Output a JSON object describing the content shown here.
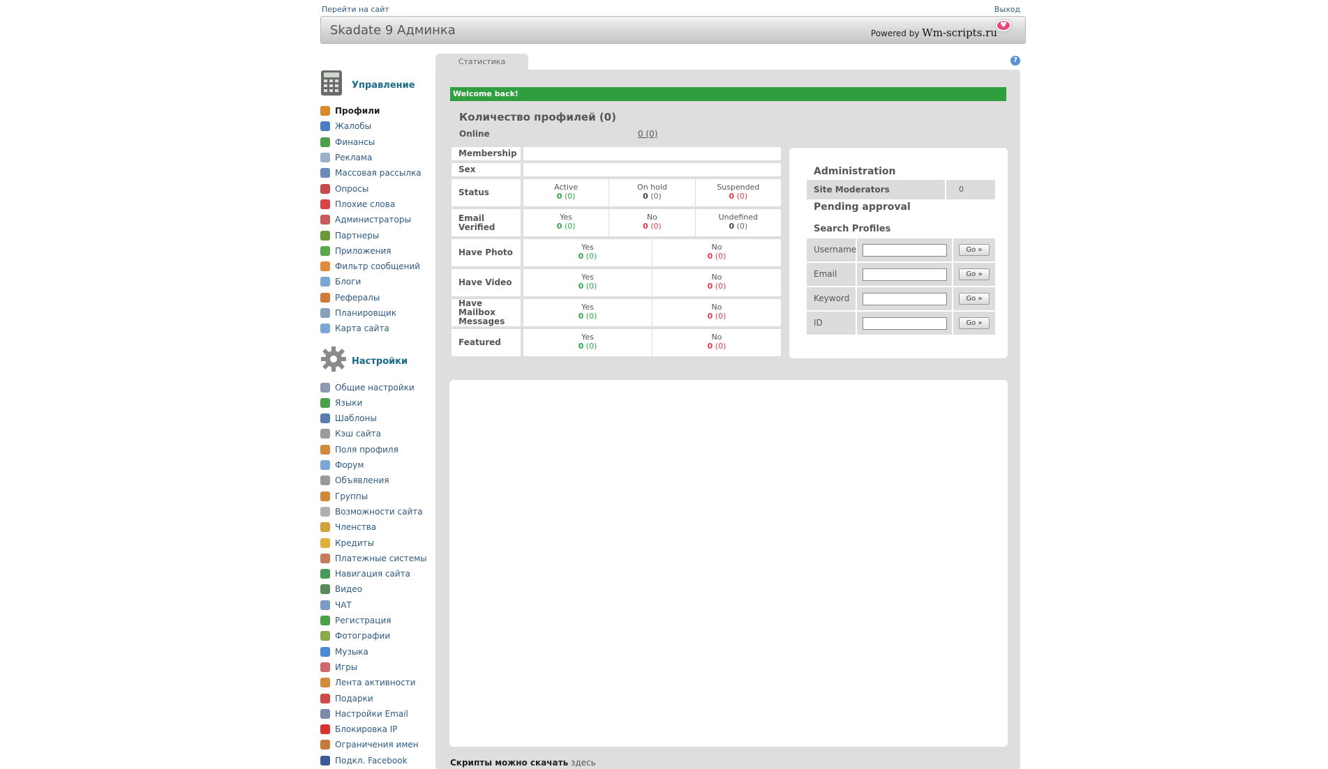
{
  "top": {
    "left_link": "Перейти на сайт",
    "right_link": "Выход"
  },
  "header": {
    "title": "Skadate 9 Админка",
    "powered_prefix": "Powered by",
    "powered_brand": "Wm-scripts.ru"
  },
  "sidebar": {
    "management": {
      "title": "Управление",
      "items": [
        {
          "label": "Профили",
          "color": "#d98a2a"
        },
        {
          "label": "Жалобы",
          "color": "#4a7ec4"
        },
        {
          "label": "Финансы",
          "color": "#4aa14a"
        },
        {
          "label": "Реклама",
          "color": "#9ab0c8"
        },
        {
          "label": "Массовая рассылка",
          "color": "#6d8ab8"
        },
        {
          "label": "Опросы",
          "color": "#c84a4a"
        },
        {
          "label": "Плохие слова",
          "color": "#d94343"
        },
        {
          "label": "Администраторы",
          "color": "#c85a5a"
        },
        {
          "label": "Партнеры",
          "color": "#6a9a3a"
        },
        {
          "label": "Приложения",
          "color": "#5aa84a"
        },
        {
          "label": "Фильтр сообщений",
          "color": "#e08a3a"
        },
        {
          "label": "Блоги",
          "color": "#7aa6d8"
        },
        {
          "label": "Рефералы",
          "color": "#d07a3a"
        },
        {
          "label": "Планировщик",
          "color": "#8aa0c0"
        },
        {
          "label": "Карта сайта",
          "color": "#7aa6d8"
        }
      ]
    },
    "settings": {
      "title": "Настройки",
      "items": [
        {
          "label": "Общие настройки",
          "color": "#8a9ab0"
        },
        {
          "label": "Языки",
          "color": "#4aa14a"
        },
        {
          "label": "Шаблоны",
          "color": "#5a7ab0"
        },
        {
          "label": "Кэш сайта",
          "color": "#9a9a9a"
        },
        {
          "label": "Поля профиля",
          "color": "#d08a3a"
        },
        {
          "label": "Форум",
          "color": "#7aa6d8"
        },
        {
          "label": "Объявления",
          "color": "#9a9a9a"
        },
        {
          "label": "Группы",
          "color": "#d08a3a"
        },
        {
          "label": "Возможности сайта",
          "color": "#b0b0b0"
        },
        {
          "label": "Членства",
          "color": "#d0a23a"
        },
        {
          "label": "Кредиты",
          "color": "#e0b03a"
        },
        {
          "label": "Платежные системы",
          "color": "#c87a5a"
        },
        {
          "label": "Навигация сайта",
          "color": "#4a9a5a"
        },
        {
          "label": "Видео",
          "color": "#5a8a5a"
        },
        {
          "label": "ЧАТ",
          "color": "#7a9ac8"
        },
        {
          "label": "Регистрация",
          "color": "#4aa14a"
        },
        {
          "label": "Фотографии",
          "color": "#8aaa4a"
        },
        {
          "label": "Музыка",
          "color": "#4a8ad8"
        },
        {
          "label": "Игры",
          "color": "#d06a6a"
        },
        {
          "label": "Лента активности",
          "color": "#d08a3a"
        },
        {
          "label": "Подарки",
          "color": "#d04a4a"
        },
        {
          "label": "Настройки Email",
          "color": "#7a8aa8"
        },
        {
          "label": "Блокировка IP",
          "color": "#d93030"
        },
        {
          "label": "Ограничения имен",
          "color": "#c87a3a"
        },
        {
          "label": "Подкл. Facebook",
          "color": "#3b5998"
        }
      ]
    }
  },
  "main": {
    "tab": "Статистика",
    "help": "?",
    "welcome": "Welcome back!",
    "count_title": "Количество профилей (0)",
    "online_label": "Online",
    "online_value": "0 (0)",
    "stats": {
      "membership": "Membership",
      "sex": "Sex",
      "status": {
        "label": "Status",
        "cols": [
          {
            "name": "Active",
            "value": "0",
            "paren": "(0)",
            "tone": "green"
          },
          {
            "name": "On hold",
            "value": "0",
            "paren": "(0)",
            "tone": "black"
          },
          {
            "name": "Suspended",
            "value": "0",
            "paren": "(0)",
            "tone": "red"
          }
        ]
      },
      "email": {
        "label": "Email Verified",
        "cols": [
          {
            "name": "Yes",
            "value": "0",
            "paren": "(0)",
            "tone": "green"
          },
          {
            "name": "No",
            "value": "0",
            "paren": "(0)",
            "tone": "red"
          },
          {
            "name": "Undefined",
            "value": "0",
            "paren": "(0)",
            "tone": "black"
          }
        ]
      },
      "photo": {
        "label": "Have Photo",
        "cols": [
          {
            "name": "Yes",
            "value": "0",
            "paren": "(0)",
            "tone": "green"
          },
          {
            "name": "No",
            "value": "0",
            "paren": "(0)",
            "tone": "red"
          }
        ]
      },
      "video": {
        "label": "Have Video",
        "cols": [
          {
            "name": "Yes",
            "value": "0",
            "paren": "(0)",
            "tone": "green"
          },
          {
            "name": "No",
            "value": "0",
            "paren": "(0)",
            "tone": "red"
          }
        ]
      },
      "mailbox": {
        "label": "Have Mailbox Messages",
        "cols": [
          {
            "name": "Yes",
            "value": "0",
            "paren": "(0)",
            "tone": "green"
          },
          {
            "name": "No",
            "value": "0",
            "paren": "(0)",
            "tone": "red"
          }
        ]
      },
      "featured": {
        "label": "Featured",
        "cols": [
          {
            "name": "Yes",
            "value": "0",
            "paren": "(0)",
            "tone": "green"
          },
          {
            "name": "No",
            "value": "0",
            "paren": "(0)",
            "tone": "red"
          }
        ]
      }
    },
    "admin": {
      "title": "Administration",
      "moderators_label": "Site Moderators",
      "moderators_value": "0",
      "pending": "Pending approval",
      "search_title": "Search Profiles",
      "rows": [
        {
          "label": "Username",
          "value": "",
          "button": "Go »"
        },
        {
          "label": "Email",
          "value": "",
          "button": "Go »"
        },
        {
          "label": "Keyword",
          "value": "",
          "button": "Go »"
        },
        {
          "label": "ID",
          "value": "",
          "button": "Go »"
        }
      ]
    },
    "footer": {
      "text": "Скрипты можно скачать",
      "link": "здесь"
    }
  }
}
